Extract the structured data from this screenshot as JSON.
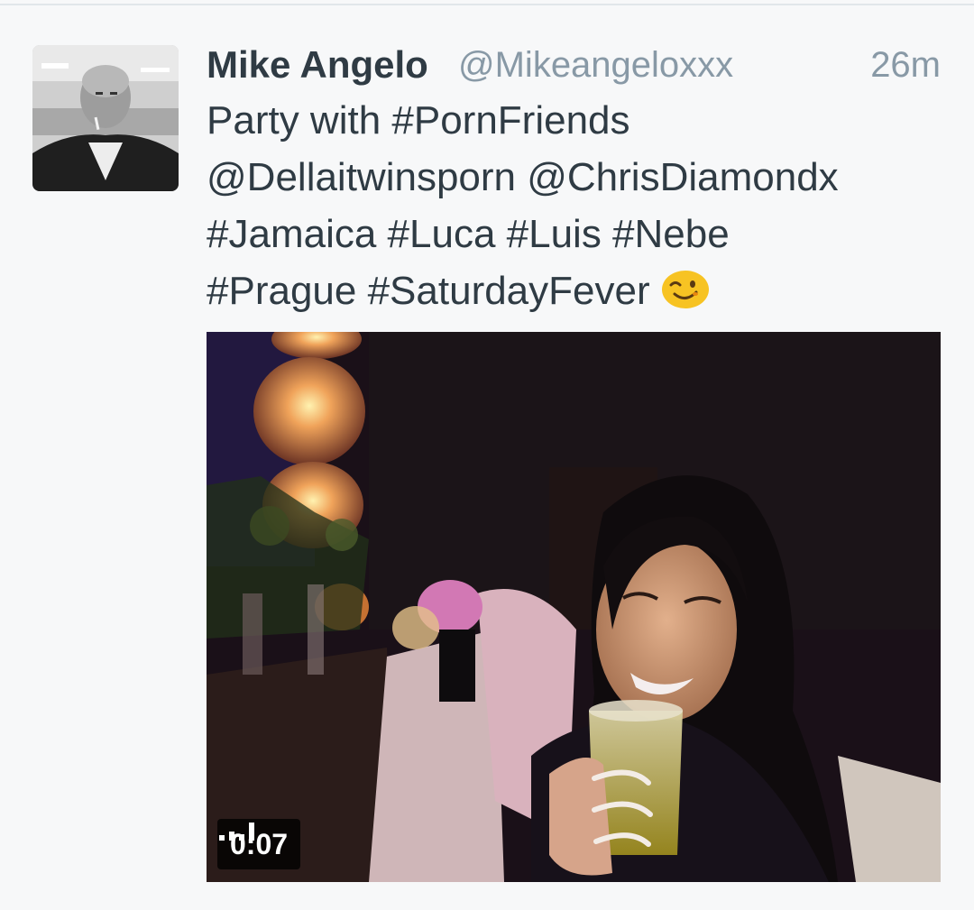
{
  "tweet": {
    "display_name": "Mike Angelo",
    "handle": "@Mikeangeloxxx",
    "timestamp": "26m",
    "text_lines": [
      "Party with #PornFriends",
      "@Dellaitwinsporn @ChrisDiamondx",
      "#Jamaica #Luca #Luis #Nebe",
      "#Prague #SaturdayFever"
    ],
    "emoji": "winking-face-icon"
  },
  "media": {
    "type": "video",
    "duration": "0:07",
    "volume_icon": "volume-bars-icon"
  },
  "colors": {
    "name": "#2f3b44",
    "meta": "#8899a6",
    "background": "#f7f8f9"
  }
}
